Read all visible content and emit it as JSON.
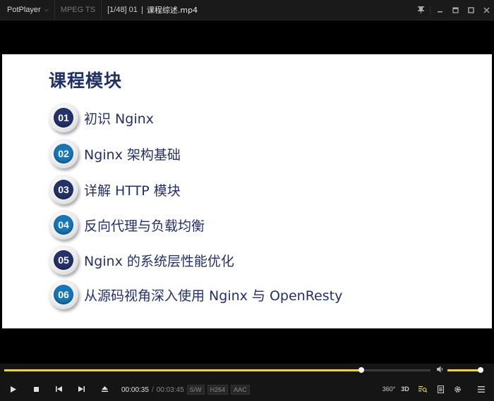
{
  "titlebar": {
    "app_name": "PotPlayer",
    "format": "MPEG TS",
    "playlist_position": "[1/48] 01",
    "filename": "课程综述.mp4"
  },
  "slide": {
    "title": "课程模块",
    "items": [
      {
        "num": "01",
        "text": "初识 Nginx",
        "style": "dark"
      },
      {
        "num": "02",
        "text": "Nginx 架构基础",
        "style": "blue"
      },
      {
        "num": "03",
        "text": "详解 HTTP 模块",
        "style": "dark"
      },
      {
        "num": "04",
        "text": "反向代理与负载均衡",
        "style": "blue"
      },
      {
        "num": "05",
        "text": "Nginx 的系统层性能优化",
        "style": "dark"
      },
      {
        "num": "06",
        "text": "从源码视角深入使用 Nginx 与 OpenResty",
        "style": "blue"
      }
    ]
  },
  "playback": {
    "current_time": "00:00:35",
    "separator": "/",
    "total_time": "00:03:45",
    "progress": 0.838,
    "volume": 0.92,
    "tags": [
      "S/W",
      "H264",
      "AAC"
    ]
  },
  "controls_right": {
    "vr_label": "360°",
    "three_d_label": "3D"
  },
  "colors": {
    "accent": "#e8d24a",
    "slide_title": "#1f3068",
    "badge_dark": "#24326a",
    "badge_blue": "#1576b8"
  }
}
